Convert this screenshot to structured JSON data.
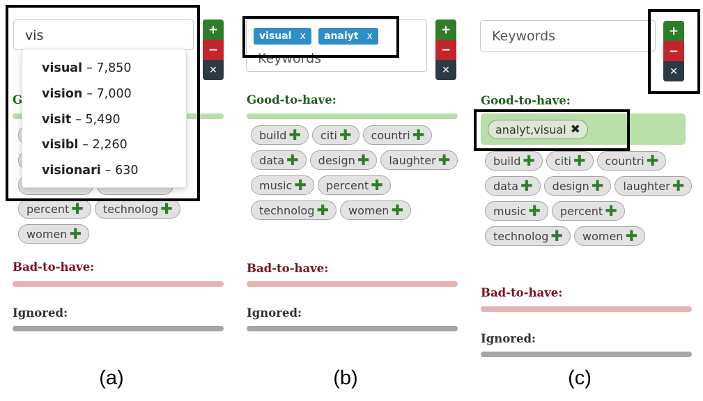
{
  "panel_a": {
    "search_value": "vis",
    "suggestions": [
      {
        "term": "visual",
        "count": "– 7,850"
      },
      {
        "term": "vision",
        "count": "– 7,000"
      },
      {
        "term": "visit",
        "count": "– 5,490"
      },
      {
        "term": "visibl",
        "count": "– 2,260"
      },
      {
        "term": "visionari",
        "count": "– 630"
      }
    ],
    "visible_tags": [
      "percent",
      "technolog",
      "women"
    ],
    "caption": "(a)"
  },
  "panel_b": {
    "chips": [
      "visual",
      "analyt"
    ],
    "chip_remove": "x",
    "placeholder": "Keywords",
    "tags": [
      "build",
      "citi",
      "countri",
      "data",
      "design",
      "laughter",
      "music",
      "percent",
      "technolog",
      "women"
    ],
    "caption": "(b)"
  },
  "panel_c": {
    "placeholder": "Keywords",
    "group_tag": "analyt,visual",
    "tags": [
      "build",
      "citi",
      "countri",
      "data",
      "design",
      "laughter",
      "music",
      "percent",
      "technolog",
      "women"
    ],
    "caption": "(c)"
  },
  "buttons": {
    "plus": "+",
    "minus": "−",
    "clear": "✕"
  },
  "sections": {
    "good": "Good-to-have:",
    "bad": "Bad-to-have:",
    "ignored": "Ignored:"
  },
  "icons": {
    "add_tag": "plus-icon",
    "remove_group": "close-icon"
  },
  "colors": {
    "plus_button": "#2e7d2a",
    "minus_button": "#c0262c",
    "clear_button": "#2c3a44",
    "good_bar": "#b8dfa8",
    "bad_bar": "#e6b2b2",
    "ignored_bar": "#a6a6a6",
    "chip": "#2e8fc6"
  }
}
